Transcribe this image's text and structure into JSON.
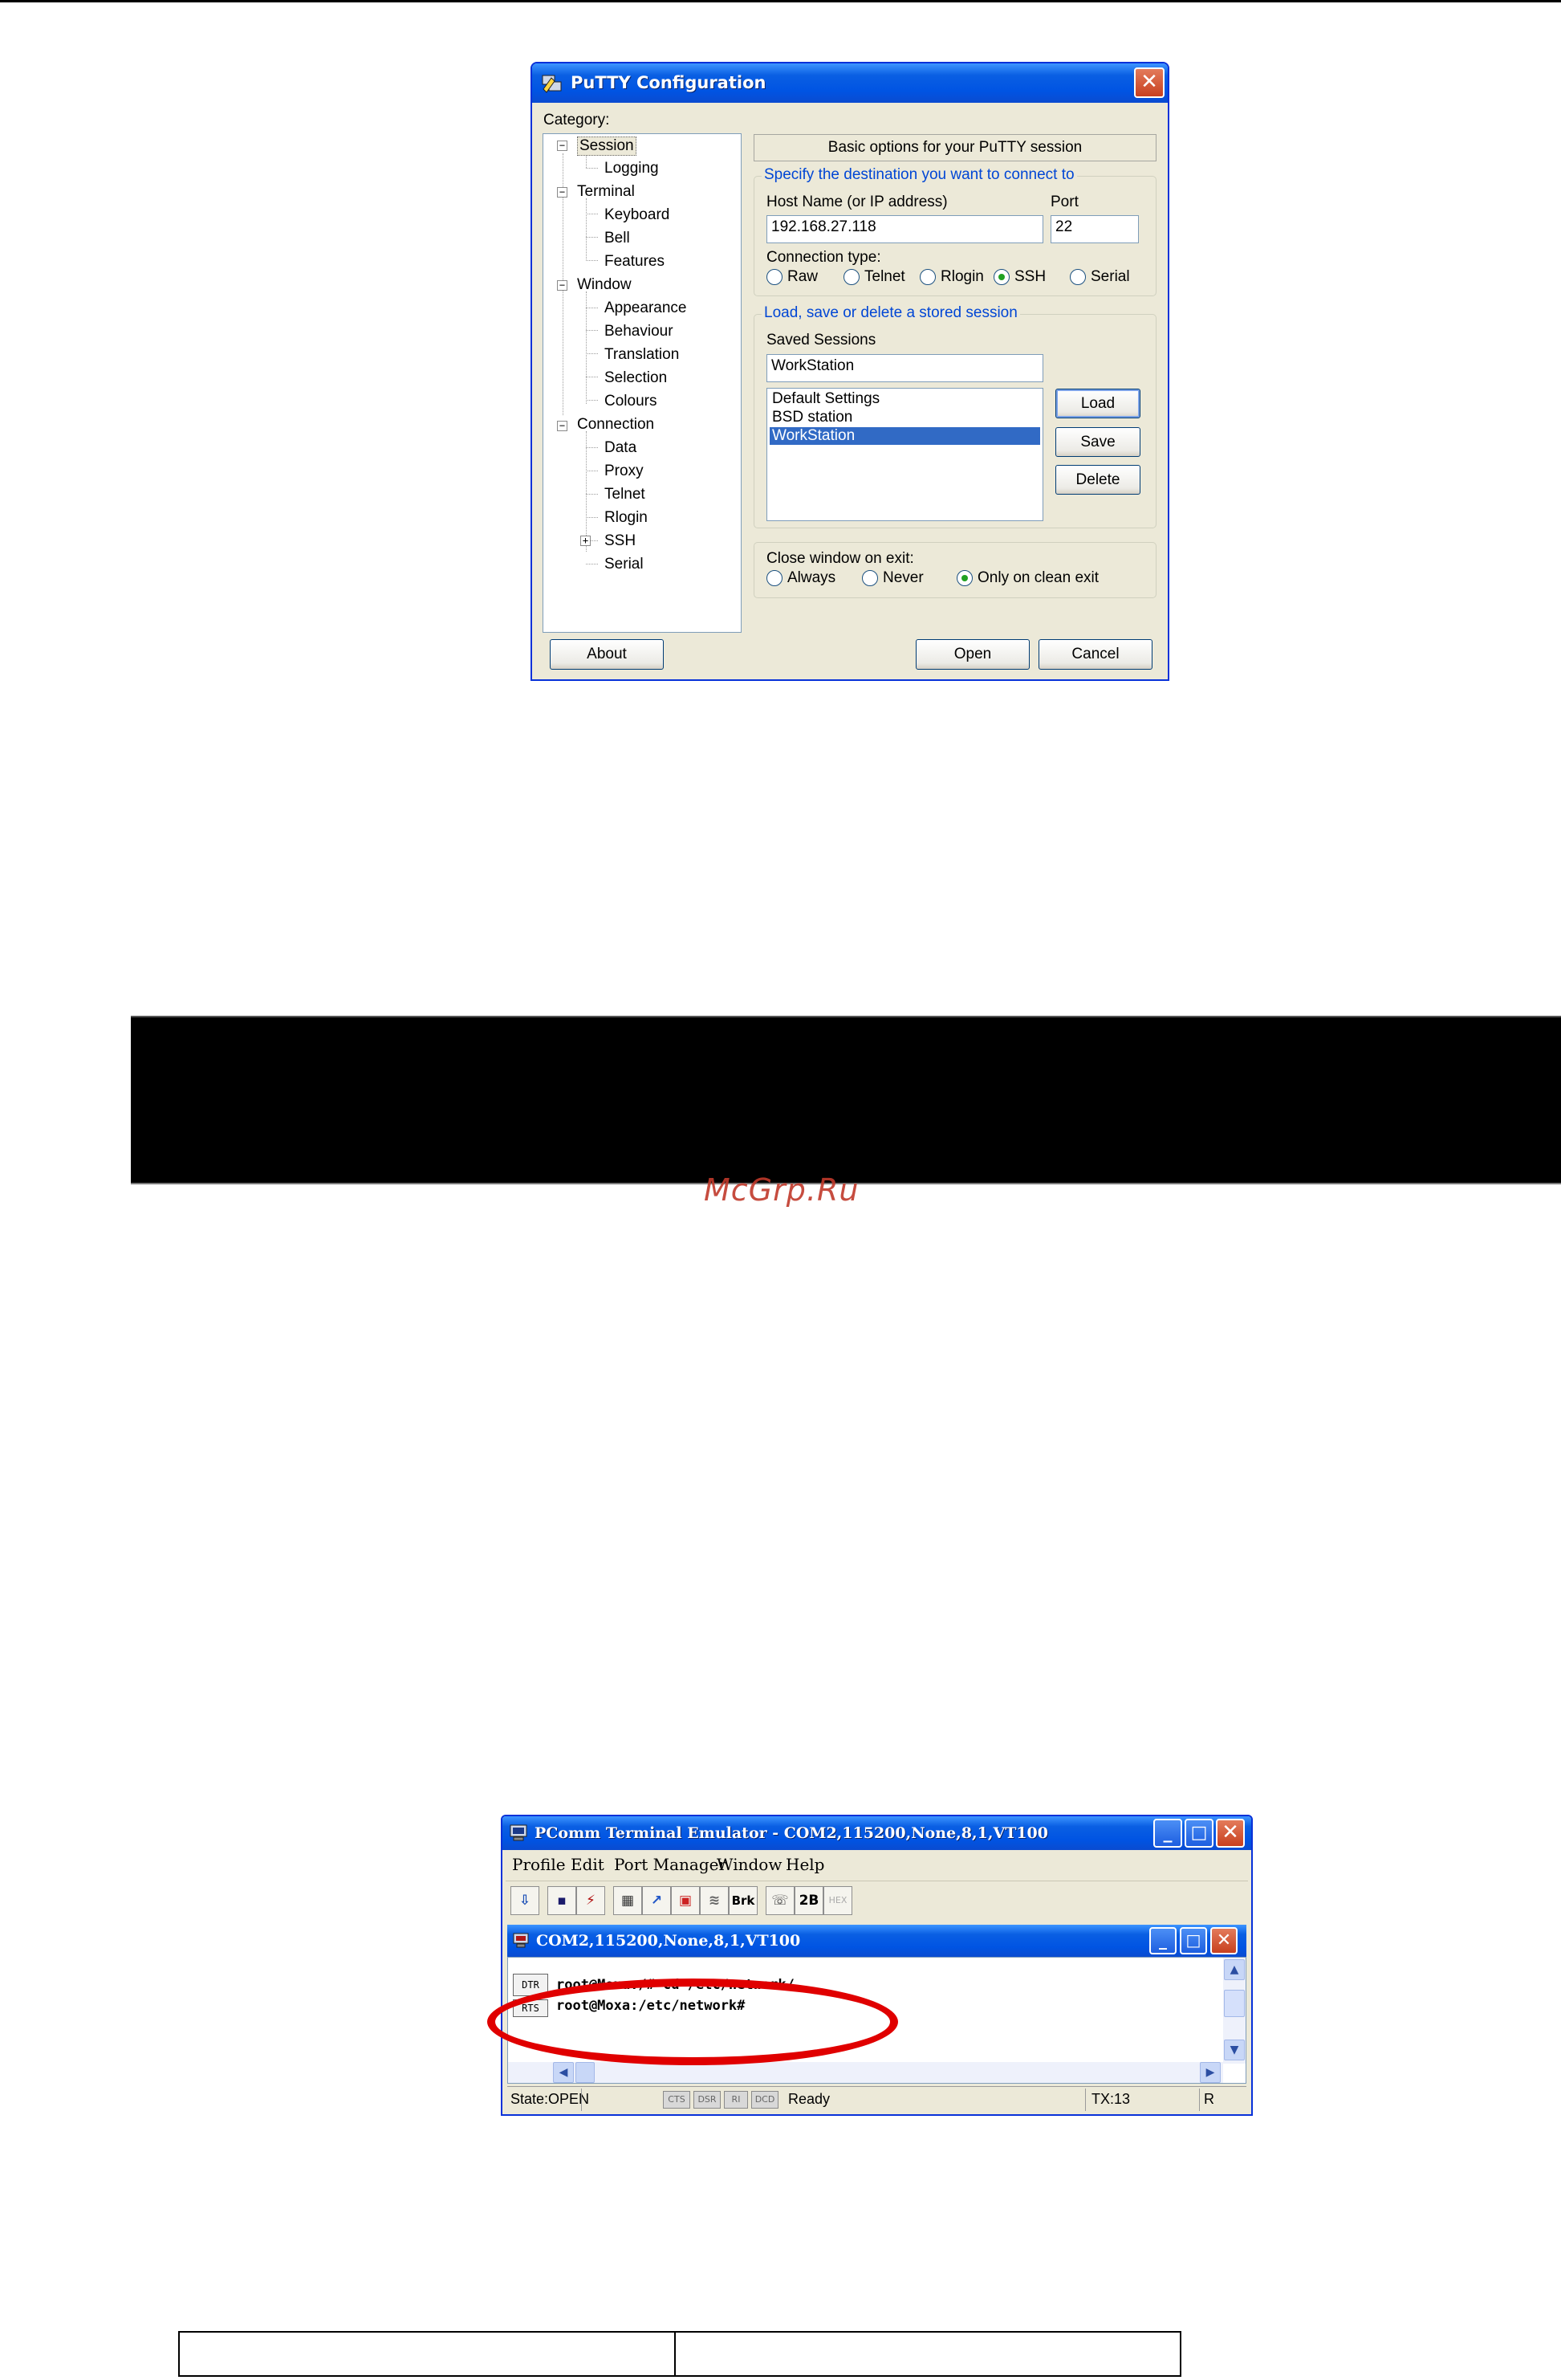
{
  "putty": {
    "title": "PuTTY Configuration",
    "category_label": "Category:",
    "tree": [
      "Session",
      "Logging",
      "Terminal",
      "Keyboard",
      "Bell",
      "Features",
      "Window",
      "Appearance",
      "Behaviour",
      "Translation",
      "Selection",
      "Colours",
      "Connection",
      "Data",
      "Proxy",
      "Telnet",
      "Rlogin",
      "SSH",
      "Serial"
    ],
    "header": "Basic options for your PuTTY session",
    "destination_group": "Specify the destination you want to connect to",
    "host_label": "Host Name (or IP address)",
    "port_label": "Port",
    "host_value": "192.168.27.118",
    "port_value": "22",
    "conn_type_label": "Connection type:",
    "conn_types": [
      "Raw",
      "Telnet",
      "Rlogin",
      "SSH",
      "Serial"
    ],
    "selected_conn_type": "SSH",
    "sessions_group": "Load, save or delete a stored session",
    "saved_sessions_label": "Saved Sessions",
    "saved_sessions_value": "WorkStation",
    "sessions": [
      "Default Settings",
      "BSD station",
      "WorkStation"
    ],
    "selected_session": "WorkStation",
    "load_label": "Load",
    "save_label": "Save",
    "delete_label": "Delete",
    "close_label": "Close window on exit:",
    "close_options": [
      "Always",
      "Never",
      "Only on clean exit"
    ],
    "selected_close": "Only on clean exit",
    "about_label": "About",
    "open_label": "Open",
    "cancel_label": "Cancel"
  },
  "watermark": "McGrp.Ru",
  "pcomm": {
    "title": "PComm Terminal Emulator - COM2,115200,None,8,1,VT100",
    "menu": [
      "Profile",
      "Edit",
      "Port Manager",
      "Window",
      "Help"
    ],
    "toolbar": {
      "brk_label": "Brk",
      "twob_label": "2B",
      "hex_label": "HEX"
    },
    "inner_title": "COM2,115200,None,8,1,VT100",
    "terminal_lines": [
      "root@Moxa:/# cd /etc/network/",
      "root@Moxa:/etc/network#"
    ],
    "side_labels": {
      "dtr": "DTR",
      "rts": "RTS"
    },
    "status": {
      "state": "State:OPEN",
      "leds": [
        "CTS",
        "DSR",
        "RI",
        "DCD"
      ],
      "ready": "Ready",
      "tx": "TX:13",
      "rx": "R"
    }
  },
  "colors": {
    "xp_blue": "#0054e3",
    "highlight": "#316ac5",
    "annotation_red": "#e00000",
    "watermark": "#c0392b"
  }
}
